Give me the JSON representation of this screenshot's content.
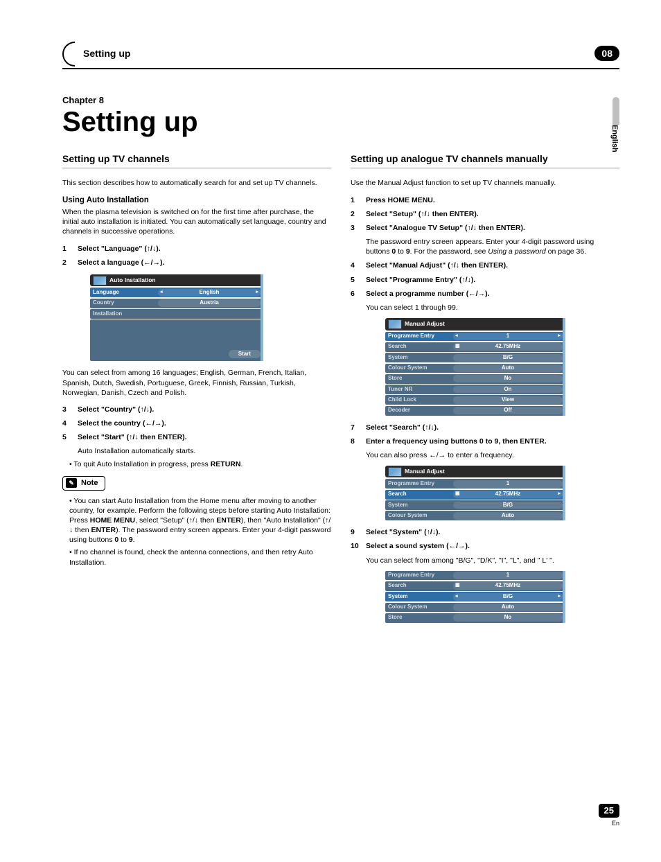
{
  "header": {
    "running_title": "Setting up",
    "chapter_number": "08",
    "side_lang": "English"
  },
  "title_block": {
    "chapter_label": "Chapter 8",
    "main_title": "Setting up"
  },
  "left": {
    "section_title": "Setting up TV channels",
    "intro": "This section describes how to automatically search for and set up TV channels.",
    "sub_head": "Using Auto Installation",
    "sub_intro": "When the plasma television is switched on for the first time after purchase, the initial auto installation is initiated. You can automatically set language, country and channels in successive operations.",
    "step1": "Select \"Language\" (↑/↓).",
    "step2": "Select a language (←/→).",
    "osd1": {
      "title": "Auto Installation",
      "rows": [
        {
          "label": "Language",
          "value": "English"
        },
        {
          "label": "Country",
          "value": "Austria"
        },
        {
          "label": "Installation",
          "value": ""
        }
      ],
      "start": "Start"
    },
    "after_osd": "You can select from among 16 languages; English, German, French, Italian, Spanish, Dutch, Swedish, Portuguese, Greek, Finnish, Russian, Turkish, Norwegian, Danish, Czech and Polish.",
    "step3": "Select \"Country\" (↑/↓).",
    "step4": "Select the country (←/→).",
    "step5": "Select \"Start\" (↑/↓ then ENTER).",
    "step5_follow": "Auto Installation automatically starts.",
    "bullet1_pre": "To quit Auto Installation in progress, press ",
    "bullet1_bold": "RETURN",
    "bullet1_post": ".",
    "note_label": "Note",
    "note1_a": "You can start Auto Installation from the Home menu after moving to another country, for example. Perform the following steps before starting Auto Installation: Press ",
    "note1_b": "HOME MENU",
    "note1_c": ", select \"Setup\" (↑/↓ then ",
    "note1_d": "ENTER",
    "note1_e": "), then \"Auto Installation\" (↑/↓ then ",
    "note1_f": "ENTER",
    "note1_g": "). The password entry screen appears. Enter your 4-digit password using buttons ",
    "note1_h": "0",
    "note1_i": " to ",
    "note1_j": "9",
    "note1_k": ".",
    "note2": "If no channel is found, check the antenna connections, and then retry Auto Installation."
  },
  "right": {
    "section_title": "Setting up analogue TV channels manually",
    "intro": "Use the Manual Adjust function to set up TV channels manually.",
    "step1": "Press HOME MENU.",
    "step2": "Select \"Setup\" (↑/↓ then ENTER).",
    "step3": "Select \"Analogue TV Setup\" (↑/↓ then ENTER).",
    "step3_follow_a": "The password entry screen appears. Enter your 4-digit password using buttons ",
    "step3_follow_b": "0",
    "step3_follow_c": " to ",
    "step3_follow_d": "9",
    "step3_follow_e": ". For the password, see ",
    "step3_follow_f": "Using a password",
    "step3_follow_g": " on page 36.",
    "step4": "Select \"Manual Adjust\" (↑/↓ then ENTER).",
    "step5": "Select \"Programme Entry\" (↑/↓).",
    "step6": "Select a programme number (←/→).",
    "step6_follow": "You can select 1 through 99.",
    "osd2": {
      "title": "Manual Adjust",
      "rows": [
        {
          "label": "Programme Entry",
          "value": "1"
        },
        {
          "label": "Search",
          "value": "42.75MHz"
        },
        {
          "label": "System",
          "value": "B/G"
        },
        {
          "label": "Colour System",
          "value": "Auto"
        },
        {
          "label": "Store",
          "value": "No"
        },
        {
          "label": "Tuner NR",
          "value": "On"
        },
        {
          "label": "Child Lock",
          "value": "View"
        },
        {
          "label": "Decoder",
          "value": "Off"
        }
      ]
    },
    "step7": "Select \"Search\" (↑/↓).",
    "step8": "Enter a frequency using buttons 0 to 9, then ENTER.",
    "step8_follow": "You can also press ←/→ to enter a frequency.",
    "osd3": {
      "title": "Manual Adjust",
      "rows": [
        {
          "label": "Programme Entry",
          "value": "1"
        },
        {
          "label": "Search",
          "value": "42.75MHz"
        },
        {
          "label": "System",
          "value": "B/G"
        },
        {
          "label": "Colour System",
          "value": "Auto"
        }
      ]
    },
    "step9": "Select \"System\" (↑/↓).",
    "step10": "Select a sound system (←/→).",
    "step10_follow": "You can select from among \"B/G\", \"D/K\", \"I\", \"L\", and \" L' \".",
    "osd4": {
      "rows": [
        {
          "label": "Programme Entry",
          "value": "1"
        },
        {
          "label": "Search",
          "value": "42.75MHz"
        },
        {
          "label": "System",
          "value": "B/G"
        },
        {
          "label": "Colour System",
          "value": "Auto"
        },
        {
          "label": "Store",
          "value": "No"
        }
      ]
    }
  },
  "footer": {
    "page": "25",
    "lang": "En"
  }
}
